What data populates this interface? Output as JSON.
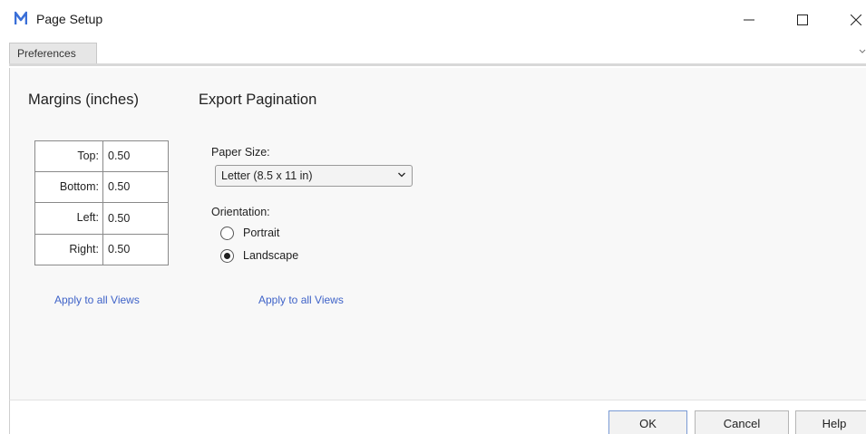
{
  "window": {
    "title": "Page Setup",
    "app_logo": "M",
    "controls": {
      "minimize": "—",
      "maximize": "☐",
      "close": "✕"
    }
  },
  "tabs": [
    {
      "label": "Preferences",
      "active": true
    }
  ],
  "tab_overflow_icon": "chevron-down-icon",
  "margins": {
    "heading": "Margins (inches)",
    "rows": [
      {
        "label": "Top:",
        "value": "0.50"
      },
      {
        "label": "Bottom:",
        "value": "0.50"
      },
      {
        "label": "Left:",
        "value": "0.50"
      },
      {
        "label": "Right:",
        "value": "0.50"
      }
    ],
    "apply_link": "Apply to all Views"
  },
  "export": {
    "heading": "Export Pagination",
    "paper_size_label": "Paper Size:",
    "paper_size_value": "Letter (8.5 x 11 in)",
    "orientation_label": "Orientation:",
    "orientation_options": [
      {
        "label": "Portrait",
        "selected": false
      },
      {
        "label": "Landscape",
        "selected": true
      }
    ],
    "apply_link": "Apply to all Views"
  },
  "buttons": {
    "ok": "OK",
    "cancel": "Cancel",
    "help": "Help"
  },
  "colors": {
    "logo": "#3a6fd8",
    "link": "#3f63c8",
    "panel_bg": "#f8f8f8"
  }
}
